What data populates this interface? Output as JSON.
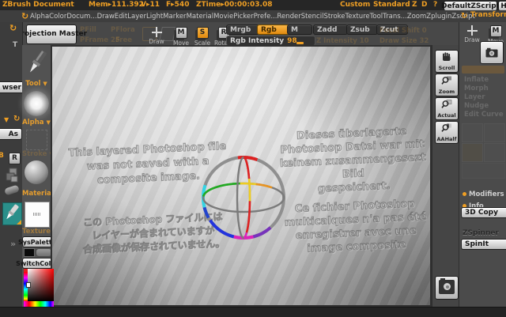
{
  "title_bar": {
    "app_title": "ZBrush Document",
    "stats": [
      "Mem▸111.392",
      "V▸11",
      "F▸540",
      "ZTime▸00:00:03.08"
    ],
    "quick_items": [
      "Custom",
      "Standard",
      "Z",
      "D",
      "?"
    ],
    "zscript_button": "DefaultZScript",
    "help_button": "Help"
  },
  "menu_bar": {
    "items": [
      "Alpha",
      "Color",
      "Docum...",
      "Draw",
      "Edit",
      "Layer",
      "Light",
      "Marker",
      "Material",
      "Movie",
      "Picker",
      "Prefe...",
      "Render",
      "Stencil",
      "Stroke",
      "Texture",
      "Tool",
      "Trans...",
      "Zoom",
      "Zplugin",
      "Zscript"
    ]
  },
  "top_shelf": {
    "projection_master": "Projection Master",
    "disabled_items": [
      "PFill",
      "PFlora",
      "PFrame 25",
      "Free"
    ],
    "modes": [
      {
        "label": "Draw"
      },
      {
        "label": "Move",
        "key": "M"
      },
      {
        "label": "Scale",
        "key": "S"
      },
      {
        "label": "Rotate",
        "key": "R"
      }
    ],
    "paint_modes": [
      "Mrgb",
      "Rgb",
      "M"
    ],
    "rgb_intensity": {
      "label": "Rgb Intensity",
      "value": "98"
    },
    "sculpt_modes": [
      "Zadd",
      "Zsub",
      "Zcut"
    ],
    "disabled_sliders": [
      {
        "label": "Focal Shift",
        "value": "0"
      },
      {
        "label": "Z Intensity",
        "value": "10"
      },
      {
        "label": "Draw Size",
        "value": "32"
      }
    ]
  },
  "left_dock": {
    "t_label": "T",
    "browser_label": "wser",
    "save_as_label": "As",
    "b_label": "B",
    "r_label": "R"
  },
  "left_palette": {
    "tool_label": "Tool",
    "alpha_label": "Alpha",
    "stroke_label": "Stroke",
    "material_label": "Material",
    "texture_label": "Texture",
    "sys_palette_button": "SysPalette",
    "switch_color_button": "SwitchColor"
  },
  "canvas": {
    "messages": {
      "english": [
        "This layered Photoshop file",
        "was not saved with a",
        "composite image."
      ],
      "german": [
        "Dieses überlagerte",
        "Photoshop Datei war mit",
        "keinem zusammengesezt Bild",
        "gespeichert."
      ],
      "japanese": [
        "この Photoshop ファイルには",
        "レイヤーが含まれていますが",
        "合成画像が保存されていません。"
      ],
      "french": [
        "Ce fichier Photoshop",
        "multicalques n'a pas été",
        "enregistrer avec une",
        "image composite"
      ]
    }
  },
  "canvas_tray": {
    "scroll": "Scroll",
    "zoom": "Zoom",
    "actual": "Actual",
    "aahalf": "AAHalf"
  },
  "right_shelf": {
    "transform_label": "Transform",
    "mode_labels": [
      "Draw",
      "Move"
    ],
    "disabled_items": [
      "Inflate",
      "Morph",
      "Layer",
      "Nudge",
      "Edit Curve"
    ],
    "modifiers_label": "Modifiers",
    "info_label": "Info",
    "copy_button": "3D Copy",
    "zspinner_label": "ZSpinner",
    "spinit_button": "SpinIt"
  },
  "icons": {
    "dropdown": "▼",
    "spin": "↻",
    "chevron": "»"
  },
  "colors": {
    "accent_orange": "#ef9f24",
    "selected_teal": "#2a8f8a",
    "canvas_light": "#ededed",
    "canvas_dark": "#989898",
    "gizmo_ring": "#8f8f8f",
    "gizmo_red": "#dd2222",
    "gizmo_yellow": "#eecc22",
    "gizmo_green": "#22aa22",
    "gizmo_cyan": "#33d5e5",
    "gizmo_blue": "#2233dd",
    "gizmo_magenta": "#dd22bb",
    "gizmo_purple": "#7733bb"
  }
}
